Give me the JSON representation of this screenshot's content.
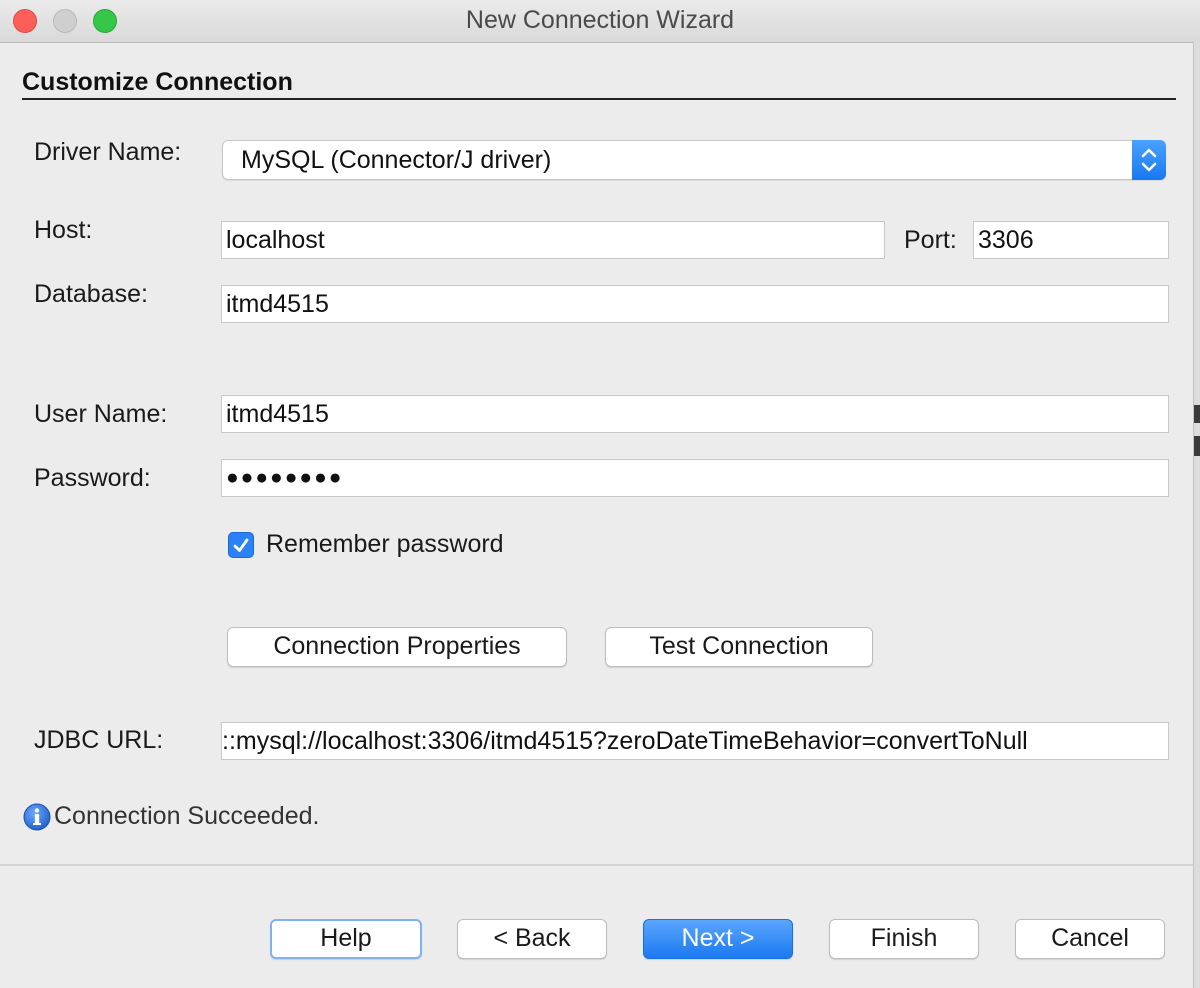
{
  "window": {
    "title": "New Connection Wizard"
  },
  "section": {
    "title": "Customize Connection"
  },
  "form": {
    "driver_label": "Driver Name:",
    "driver_value": "MySQL (Connector/J driver)",
    "host_label": "Host:",
    "host_value": "localhost",
    "port_label": "Port:",
    "port_value": "3306",
    "database_label": "Database:",
    "database_value": "itmd4515",
    "username_label": "User Name:",
    "username_value": "itmd4515",
    "password_label": "Password:",
    "password_mask": "●●●●●●●●",
    "remember_label": "Remember password",
    "remember_checked": true,
    "jdbc_label": "JDBC URL:",
    "jdbc_value": "::mysql://localhost:3306/itmd4515?zeroDateTimeBehavior=convertToNull"
  },
  "actions": {
    "connection_properties": "Connection Properties",
    "test_connection": "Test Connection"
  },
  "status": {
    "message": "Connection Succeeded.",
    "icon": "info-icon"
  },
  "footer": {
    "help": "Help",
    "back": "< Back",
    "next": "Next >",
    "finish": "Finish",
    "cancel": "Cancel"
  },
  "colors": {
    "accent": "#1b79f0",
    "window_bg": "#ececec",
    "close": "#fc5f57",
    "maximize": "#34c748"
  }
}
